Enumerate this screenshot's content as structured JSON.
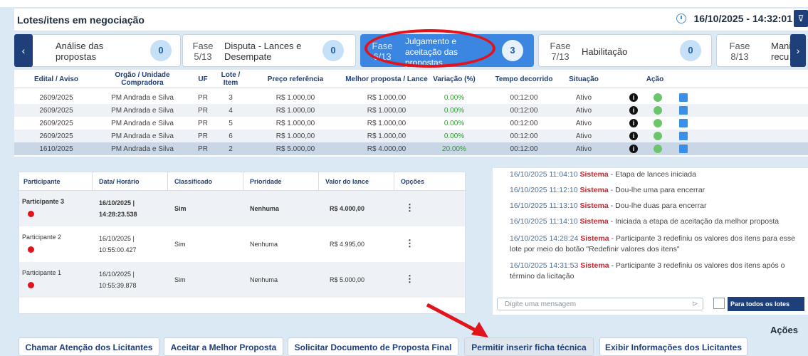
{
  "header": {
    "title": "Lotes/itens em negociação",
    "datetime": "16/10/2025 - 14:32:01",
    "filter_icon": "funnel-icon",
    "clock_icon": "clock-icon"
  },
  "phases": [
    {
      "label": "",
      "name": "Análise das propostas",
      "count": "0"
    },
    {
      "label": "Fase 5/13",
      "name": "Disputa - Lances e Desempate",
      "count": "0"
    },
    {
      "label": "Fase 6/13",
      "name": "Julgamento e aceitação das propostas",
      "count": "3",
      "active": true
    },
    {
      "label": "Fase 7/13",
      "name": "Habilitação",
      "count": "0"
    },
    {
      "label": "Fase 8/13",
      "name": "Mani recu",
      "count": ""
    }
  ],
  "nav": {
    "prev": "‹",
    "next": "›"
  },
  "lots_table": {
    "headers": [
      "Edital / Aviso",
      "Orgão / Unidade Compradora",
      "UF",
      "Lote / Item",
      "Preço referência",
      "Melhor proposta / Lance",
      "Variação (%)",
      "Tempo decorrido",
      "Situação",
      "Ação"
    ],
    "rows": [
      [
        "2609/2025",
        "PM Andrada e Silva",
        "PR",
        "3",
        "R$ 1.000,00",
        "R$ 1.000,00",
        "0.00%",
        "00:12:00",
        "Ativo"
      ],
      [
        "2609/2025",
        "PM Andrada e Silva",
        "PR",
        "4",
        "R$ 1.000,00",
        "R$ 1.000,00",
        "0.00%",
        "00:12:00",
        "Ativo"
      ],
      [
        "2609/2025",
        "PM Andrada e Silva",
        "PR",
        "5",
        "R$ 1.000,00",
        "R$ 1.000,00",
        "0.00%",
        "00:12:00",
        "Ativo"
      ],
      [
        "2609/2025",
        "PM Andrada e Silva",
        "PR",
        "6",
        "R$ 1.000,00",
        "R$ 1.000,00",
        "0.00%",
        "00:12:00",
        "Ativo"
      ],
      [
        "1610/2025",
        "PM Andrada e Silva",
        "PR",
        "2",
        "R$ 5.000,00",
        "R$ 4.000,00",
        "20.00%",
        "00:12:00",
        "Ativo"
      ]
    ]
  },
  "bids_table": {
    "headers": [
      "Participante",
      "Data/ Horário",
      "Classificado",
      "Prioridade",
      "Valor do lance",
      "Opções"
    ],
    "rows": [
      {
        "participant": "Participante 3",
        "date": "16/10/2025 |",
        "time": "14:28:23.538",
        "classified": "Sim",
        "priority": "Nenhuma",
        "value": "R$ 4.000,00",
        "options": "⋮"
      },
      {
        "participant": "Participante 2",
        "date": "16/10/2025 |",
        "time": "10:55:00.427",
        "classified": "Sim",
        "priority": "Nenhuma",
        "value": "R$ 4.995,00",
        "options": "⋮"
      },
      {
        "participant": "Participante 1",
        "date": "16/10/2025 |",
        "time": "10:55:39.878",
        "classified": "Sim",
        "priority": "Nenhuma",
        "value": "R$ 5.000,00",
        "options": "⋮"
      }
    ]
  },
  "chat": {
    "messages": [
      {
        "ts": "16/10/2025 11:04:10",
        "sender": "Sistema",
        "text": " - Etapa de lances iniciada"
      },
      {
        "ts": "16/10/2025 11:12:10",
        "sender": "Sistema",
        "text": " - Dou-lhe uma para encerrar"
      },
      {
        "ts": "16/10/2025 11:13:10",
        "sender": "Sistema",
        "text": " - Dou-lhe duas para encerrar"
      },
      {
        "ts": "16/10/2025 11:14:10",
        "sender": "Sistema",
        "text": " - Iniciada a etapa de aceitação da melhor proposta"
      },
      {
        "ts": "16/10/2025 14:28:24",
        "sender": "Sistema",
        "text": " - Participante 3 redefiniu os valores dos itens para esse lote por meio do botão \"Redefinir valores dos itens\""
      },
      {
        "ts": "16/10/2025 14:31:53",
        "sender": "Sistema",
        "text": " - Participante 3 redefiniu os valores dos itens após o término da licitação"
      }
    ],
    "placeholder": "Digite uma mensagem",
    "all_lots_label": "Para todos os lotes"
  },
  "actions": {
    "title": "Ações",
    "buttons": [
      "Chamar Atenção dos Licitantes",
      "Aceitar a Melhor Proposta",
      "Solicitar Documento de Proposta Final",
      "Permitir inserir ficha técnica",
      "Exibir Informações dos Licitantes"
    ]
  },
  "colors": {
    "accent": "#1f3f7a",
    "active_phase": "#3a86e0",
    "highlight": "#e2131a"
  }
}
